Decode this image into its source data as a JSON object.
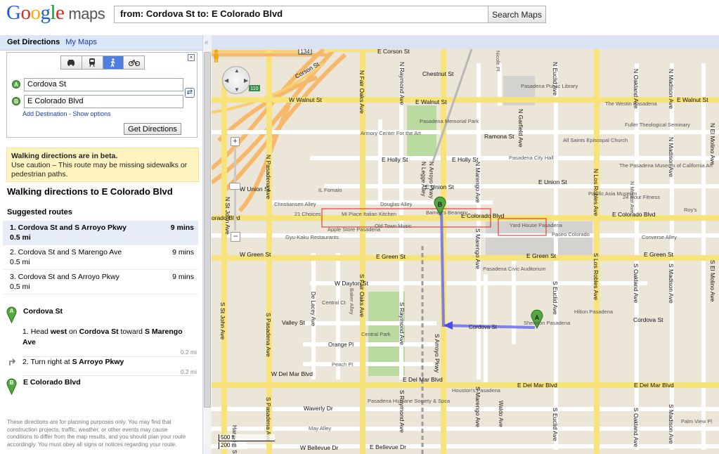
{
  "header": {
    "logo_letters": [
      "G",
      "o",
      "o",
      "g",
      "l",
      "e"
    ],
    "logo_suffix": "maps",
    "search_value": "from: Cordova St to: E Colorado Blvd",
    "search_button": "Search Maps"
  },
  "panel": {
    "tab_active": "Get Directions",
    "tab_link": "My Maps",
    "collapse_glyph": "«",
    "modes": [
      {
        "name": "car-icon",
        "glyph": "🚗",
        "active": false
      },
      {
        "name": "transit-icon",
        "glyph": "🚆",
        "active": false
      },
      {
        "name": "walk-icon",
        "glyph": "🚶",
        "active": true
      },
      {
        "name": "bike-icon",
        "glyph": "🚲",
        "active": false
      }
    ],
    "close_glyph": "×",
    "start": {
      "marker": "A",
      "value": "Cordova St"
    },
    "end": {
      "marker": "B",
      "value": "E Colorado Blvd"
    },
    "swap_glyph": "⇄",
    "add_destination": "Add Destination - Show options",
    "get_directions_button": "Get Directions",
    "beta_title": "Walking directions are in beta.",
    "beta_body": "Use caution – This route may be missing sidewalks or pedestrian paths.",
    "walk_title": "Walking directions to E Colorado Blvd",
    "suggested_routes_label": "Suggested routes",
    "routes": [
      {
        "name": "1. Cordova St and S Arroyo Pkwy",
        "time": "9 mins",
        "dist": "0.5 mi",
        "selected": true
      },
      {
        "name": "2. Cordova St and S Marengo Ave",
        "time": "9 mins",
        "dist": "0.5 mi",
        "selected": false
      },
      {
        "name": "3. Cordova St and S Arroyo Pkwy",
        "time": "9 mins",
        "dist": "0.5 mi",
        "selected": false
      }
    ],
    "start_place": "Cordova St",
    "steps": [
      {
        "num": "1.",
        "pre": "Head ",
        "dir": "west",
        "mid": " on ",
        "road": "Cordova St",
        "post": " toward ",
        "road2": "S Marengo Ave",
        "dist": "0.2 mi"
      },
      {
        "num": "2.",
        "pre": "Turn right at ",
        "road": "S Arroyo Pkwy",
        "dist": "0.2 mi"
      }
    ],
    "end_place": "E Colorado Blvd",
    "disclaimer": "These directions are for planning purposes only. You may find that construction projects, traffic, weather, or other events may cause conditions to differ from the map results, and you should plan your route accordingly. You must obey all signs or notices regarding your route."
  },
  "map": {
    "scale_ft": "500 ft",
    "scale_m": "200 m",
    "zoom_in": "+",
    "zoom_out": "−",
    "pan_glyphs": [
      "▲",
      "▼",
      "◀",
      "▶"
    ],
    "markers": [
      {
        "letter": "A"
      },
      {
        "letter": "B"
      }
    ],
    "streets": {
      "e_corson": "E Corson St",
      "corson": "Corson St",
      "w_walnut": "W Walnut St",
      "e_walnut": "E Walnut St",
      "e_walnut_r": "E Walnut St",
      "chestnut": "Chestnut St",
      "e_holly": "E Holly St",
      "e_holly2": "E Holly St",
      "ramona": "Ramona St",
      "w_union": "W Union St",
      "e_union": "E Union St",
      "e_union2": "E Union St",
      "christiansen": "Christiansen Alley",
      "douglas": "Douglas Alley",
      "e_colorado": "E Colorado Blvd",
      "e_colorado2": "E Colorado Blvd",
      "w_colorado": "orado Blvd",
      "converse": "Converse Alley",
      "w_green": "W Green St",
      "e_green": "E Green St",
      "e_green2": "E Green St",
      "e_green3": "E Green St",
      "w_dayton": "W Dayton St",
      "central_ct": "Central Ct",
      "valley": "Valley St",
      "orange_pl": "Orange Pl",
      "peach_pl": "Peach Pl",
      "cordova": "Cordova St",
      "cordova2": "Cordova St",
      "w_del_mar": "W Del Mar Blvd",
      "e_del_mar": "E Del Mar Blvd",
      "e_del_mar2": "E Del Mar Blvd",
      "e_del_mar3": "E Del Mar Blvd",
      "waverly": "Waverly Dr",
      "may_alley": "May Alley",
      "w_bellevue": "W Bellevue Dr",
      "e_bellevue": "E Bellevue Dr",
      "palm_view": "Palm View Pl",
      "roys": "Roy's",
      "n_pasadena": "N Pasadena Ave",
      "s_pasadena": "S Pasadena Ave",
      "s_pasadena2": "S Pasadena Ave",
      "n_fair_oaks": "N Fair Oaks Ave",
      "s_fair_oaks": "S Fair Oaks Ave",
      "n_raymond": "N Raymond Ave",
      "s_raymond": "S Raymond Ave",
      "s_raymond2": "S Raymond Ave",
      "n_arroyo": "N Arroyo Pkwy",
      "s_arroyo": "S Arroyo Pkwy",
      "n_marengo": "N Marengo Ave",
      "s_marengo": "S Marengo Ave",
      "s_marengo2": "S Marengo Ave",
      "n_garfield": "N Garfield Ave",
      "n_euclid": "N Euclid Ave",
      "s_euclid": "S Euclid Ave",
      "s_euclid2": "S Euclid Ave",
      "n_los_robles": "N Los Robles Ave",
      "s_los_robles": "S Los Robles Ave",
      "n_oakland": "N Oakland Ave",
      "s_oakland": "S Oakland Ave",
      "s_oakland2": "S Oakland Ave",
      "n_madison": "N Madison Ave",
      "n_madison2": "N Madison Ave",
      "s_madison": "S Madison Ave",
      "s_madison2": "S Madison Ave",
      "n_el_molino": "N El Molino Ave",
      "s_el_molino": "S El Molino Ave",
      "s_st_john": "S St John Ave",
      "n_st_john": "N St John Ave",
      "de_lacey": "De Lacey Ave",
      "baker_alley": "Baker Alley",
      "n_legge": "N Legge Alley",
      "waldo": "Waldo Ave",
      "hardwick": "Hardwick St",
      "nicole": "Nicole Pl",
      "n_mentor": "N Mentor Ave"
    },
    "places": {
      "pasadena_library": "Pasadena Public Library",
      "pasadena_memorial_park": "Pasadena Memorial Park",
      "armory": "Armory Center For the Art",
      "westin": "The Westin Pasadena",
      "fuller": "Fuller Theological Seminary",
      "all_saints": "All Saints Episcopal Church",
      "city_hall": "Pasadena City Hall",
      "museum_ca_art": "The Pasadena Museum of California Art",
      "pacific_asia": "Pacific Asia Museum",
      "hour_fitness": "24 Hour Fitness",
      "il_fornaio": "IL Fornaio",
      "mi_piace": "Mi Piace Italian Kitchen",
      "apple": "Apple Store Pasadena",
      "old_town": "Old Town Music",
      "gyu_kaku": "Gyu-Kaku Restaurants",
      "21_choices": "21 Choices",
      "barney": "Barney's Beanery",
      "yard_house": "Yard House Pasadena",
      "paseo": "Paseo Colorado",
      "civic": "Pasadena Civic Auditorium",
      "sheraton": "Sheraton Pasadena",
      "hilton": "Hilton Pasadena",
      "central_park": "Central Park",
      "houstons": "Houston's Pasadena",
      "humane": "Pasadena Humane Society & Spca"
    },
    "shields": {
      "hwy_134": "134",
      "hwy_110": "110"
    }
  }
}
